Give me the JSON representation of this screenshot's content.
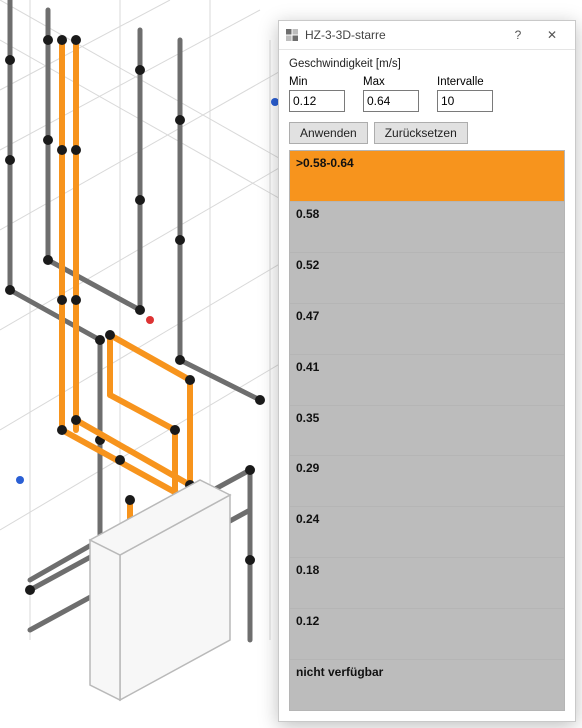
{
  "dialog": {
    "title": "HZ-3-3D-starre",
    "section_label": "Geschwindigkeit [m/s]",
    "min_label": "Min",
    "max_label": "Max",
    "interval_label": "Intervalle",
    "min_value": "0.12",
    "max_value": "0.64",
    "interval_value": "10",
    "apply_label": "Anwenden",
    "reset_label": "Zurücksetzen"
  },
  "legend": {
    "highlight_color": "#f7941d",
    "default_color": "#bcbcbc",
    "items": [
      {
        "label": ">0.58-0.64",
        "highlight": true
      },
      {
        "label": "0.58",
        "highlight": false
      },
      {
        "label": "0.52",
        "highlight": false
      },
      {
        "label": "0.47",
        "highlight": false
      },
      {
        "label": "0.41",
        "highlight": false
      },
      {
        "label": "0.35",
        "highlight": false
      },
      {
        "label": "0.29",
        "highlight": false
      },
      {
        "label": "0.24",
        "highlight": false
      },
      {
        "label": "0.18",
        "highlight": false
      },
      {
        "label": "0.12",
        "highlight": false
      },
      {
        "label": "nicht verfügbar",
        "highlight": false
      }
    ]
  },
  "icons": {
    "help_glyph": "?",
    "close_glyph": "✕"
  }
}
